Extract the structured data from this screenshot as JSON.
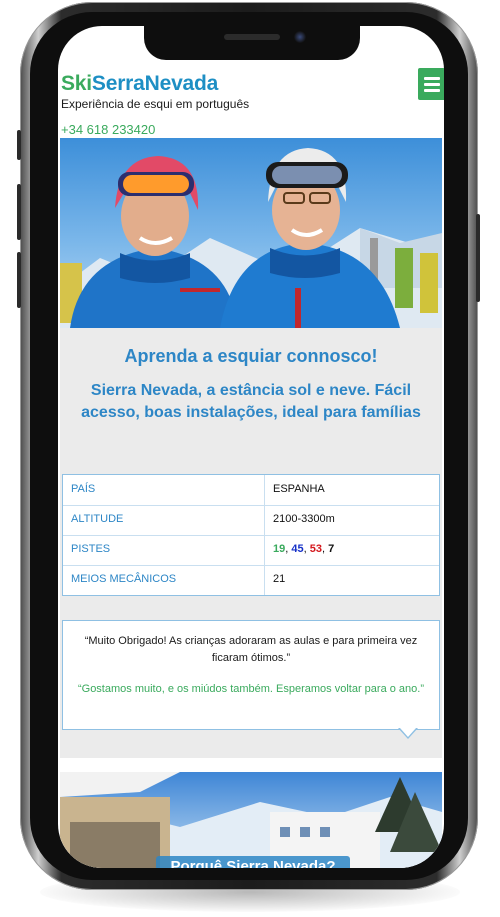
{
  "brand": {
    "part1": "Ski",
    "part2": "SerraNevada"
  },
  "tagline": "Experiência de esqui em português",
  "phone": "+34 618 233420",
  "hero_heading": "Aprenda a esquiar connosco!",
  "hero_sub": "Sierra Nevada, a estância sol e neve. Fácil acesso, boas instalações, ideal para famílias",
  "table": {
    "rows": [
      {
        "key": "PAÍS",
        "value": "ESPANHA"
      },
      {
        "key": "ALTITUDE",
        "value": "2100-3300m"
      },
      {
        "key": "PISTES",
        "value": ""
      },
      {
        "key": "MEIOS MECÂNICOS",
        "value": "21"
      }
    ],
    "pistes": {
      "green": "19",
      "blue": "45",
      "red": "53",
      "black": "7"
    }
  },
  "testimonial": {
    "quote1": "“Muito Obrigado! As crianças adoraram as aulas e para primeira vez ficaram ótimos.”",
    "quote2": "“Gostamos muito, e os miúdos também. Esperamos voltar para o ano.”"
  },
  "bottom_title": "Porquê Sierra Nevada?",
  "colors": {
    "green": "#3aaa5d",
    "blue": "#2d86c6"
  },
  "icons": {
    "menu": "hamburger-menu-icon"
  }
}
